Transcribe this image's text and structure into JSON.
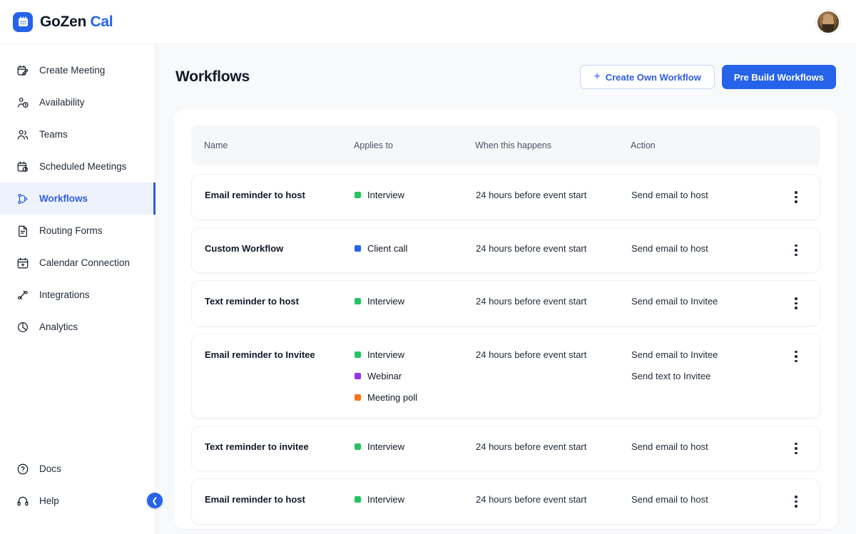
{
  "brand": {
    "name_primary": "GoZen",
    "name_accent": "Cal",
    "logo_icon": "calendar-icon"
  },
  "topbar": {
    "avatar_label": "user-avatar"
  },
  "sidebar": {
    "items": [
      {
        "label": "Create Meeting",
        "icon": "calendar-edit-icon",
        "active": false
      },
      {
        "label": "Availability",
        "icon": "person-clock-icon",
        "active": false
      },
      {
        "label": "Teams",
        "icon": "people-icon",
        "active": false
      },
      {
        "label": "Scheduled Meetings",
        "icon": "calendar-clock-icon",
        "active": false
      },
      {
        "label": "Workflows",
        "icon": "workflow-nodes-icon",
        "active": true
      },
      {
        "label": "Routing Forms",
        "icon": "document-icon",
        "active": false
      },
      {
        "label": "Calendar Connection",
        "icon": "calendar-plus-icon",
        "active": false
      },
      {
        "label": "Integrations",
        "icon": "integrations-icon",
        "active": false
      },
      {
        "label": "Analytics",
        "icon": "pie-chart-icon",
        "active": false
      }
    ],
    "bottom_items": [
      {
        "label": "Docs",
        "icon": "question-circle-icon"
      },
      {
        "label": "Help",
        "icon": "headset-icon"
      }
    ],
    "collapse_icon": "chevron-left-icon"
  },
  "page": {
    "title": "Workflows",
    "create_button": {
      "label": "Create Own Workflow",
      "icon": "plus-icon"
    },
    "prebuild_button": {
      "label": "Pre Build Workflows"
    }
  },
  "table": {
    "headers": {
      "name": "Name",
      "applies_to": "Applies to",
      "when": "When this happens",
      "action": "Action"
    },
    "menu_icon": "kebab-menu-icon",
    "rows": [
      {
        "name": "Email reminder to host",
        "tags": [
          {
            "label": "Interview",
            "color": "#22C55E"
          }
        ],
        "when": "24 hours before event start",
        "actions": [
          "Send email to host"
        ]
      },
      {
        "name": "Custom Workflow",
        "tags": [
          {
            "label": "Client call",
            "color": "#2563EB"
          }
        ],
        "when": "24 hours before event start",
        "actions": [
          "Send email to host"
        ]
      },
      {
        "name": "Text reminder to host",
        "tags": [
          {
            "label": "Interview",
            "color": "#22C55E"
          }
        ],
        "when": "24 hours before event start",
        "actions": [
          "Send email to Invitee"
        ]
      },
      {
        "name": "Email reminder to Invitee",
        "tags": [
          {
            "label": "Interview",
            "color": "#22C55E"
          },
          {
            "label": "Webinar",
            "color": "#9333EA"
          },
          {
            "label": "Meeting poll",
            "color": "#F97316"
          }
        ],
        "when": "24 hours before event start",
        "actions": [
          "Send email to Invitee",
          "Send text to Invitee"
        ]
      },
      {
        "name": "Text reminder to invitee",
        "tags": [
          {
            "label": "Interview",
            "color": "#22C55E"
          }
        ],
        "when": "24 hours before event start",
        "actions": [
          "Send email to host"
        ]
      },
      {
        "name": "Email reminder to host",
        "tags": [
          {
            "label": "Interview",
            "color": "#22C55E"
          }
        ],
        "when": "24 hours before event start",
        "actions": [
          "Send email to host"
        ]
      }
    ]
  },
  "colors": {
    "accent": "#2563EB",
    "active_nav_bg": "#EEF2FD",
    "page_bg": "#F8F9FB"
  }
}
